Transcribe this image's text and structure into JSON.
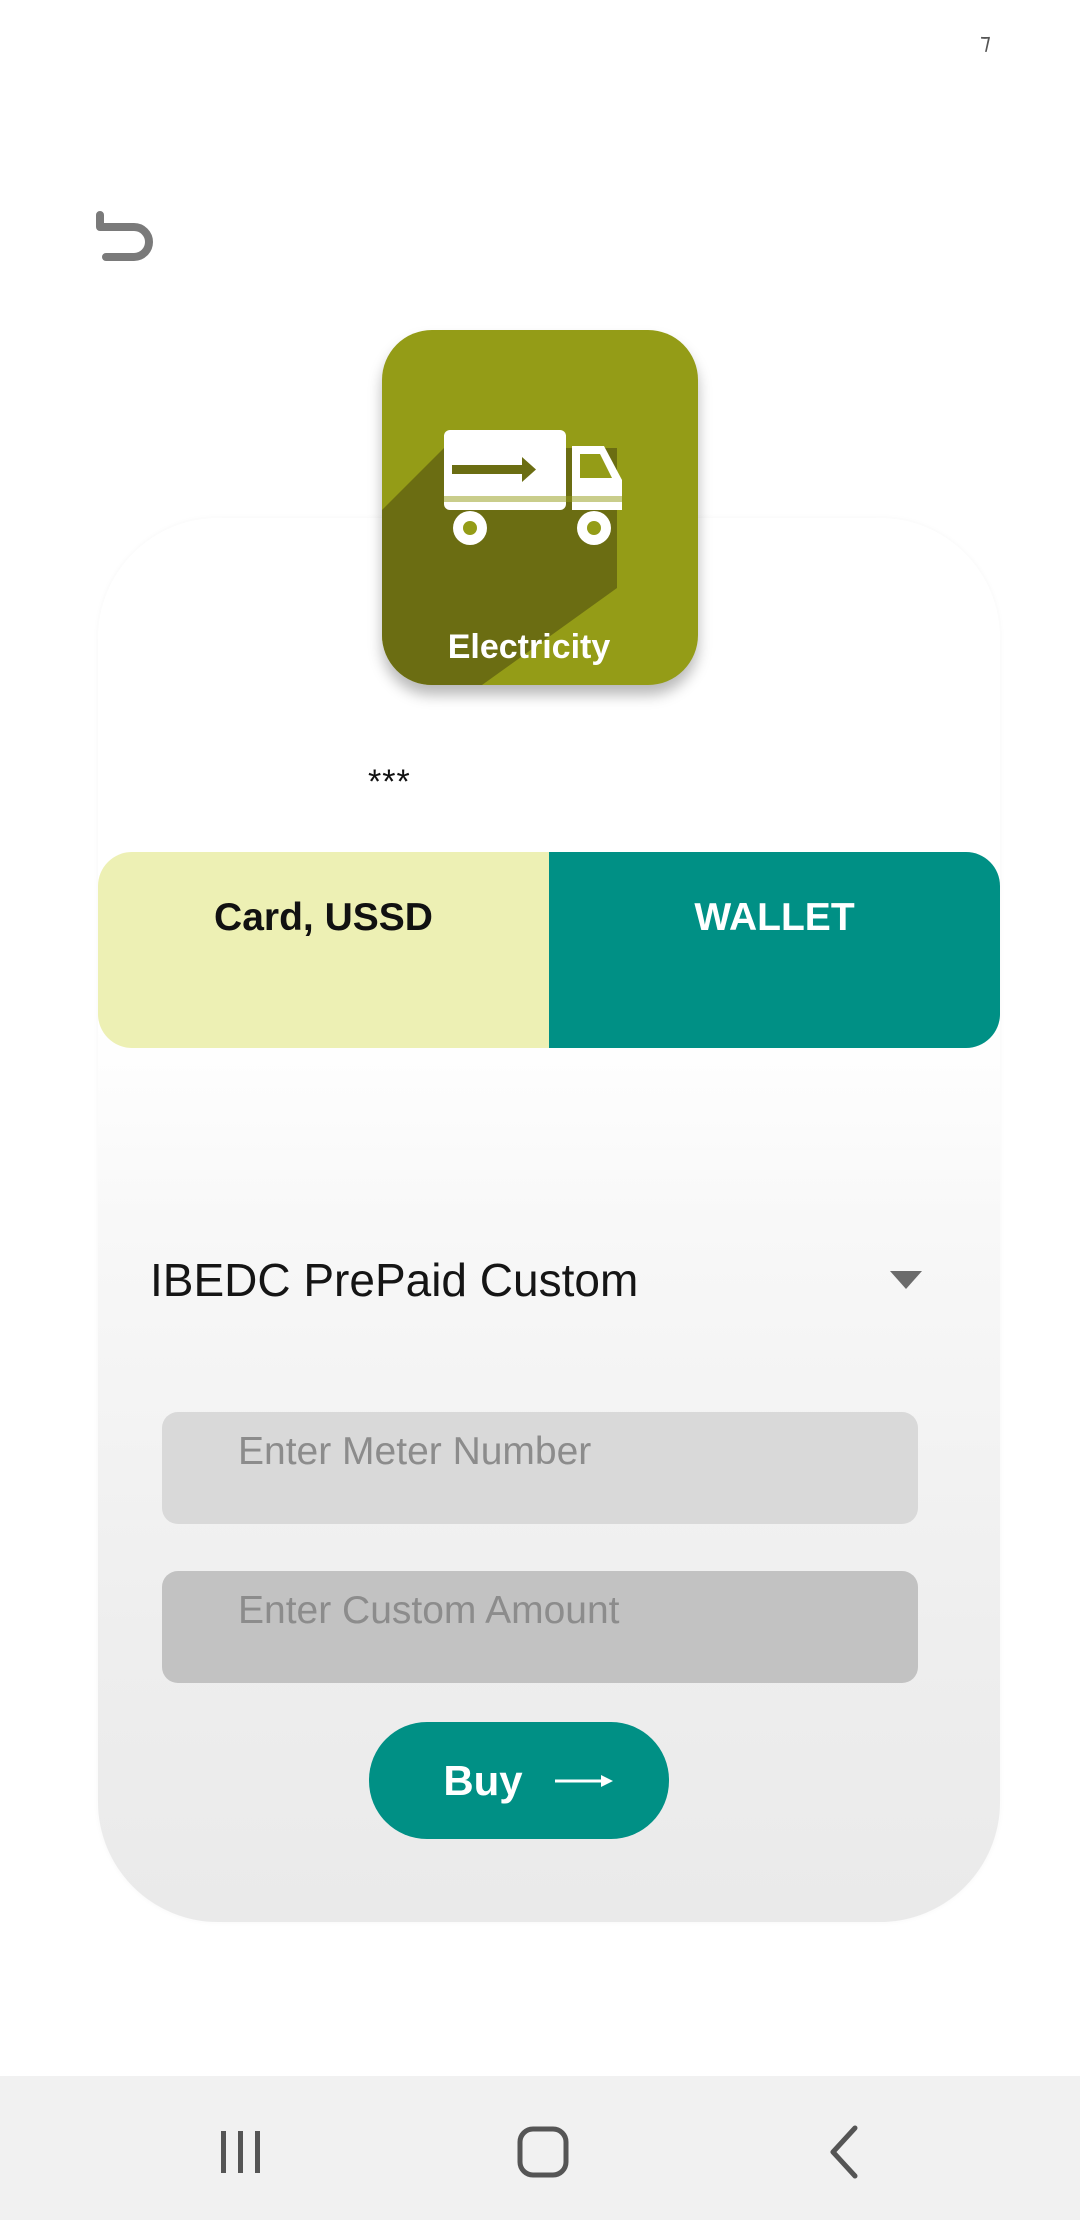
{
  "status": {
    "indicator": "⁊"
  },
  "icon_tile": {
    "label": "Electricity",
    "color": "#949c17"
  },
  "masked_text": "***",
  "payment_tabs": [
    {
      "label": "Card, USSD",
      "color": "#edf0b4"
    },
    {
      "label": "WALLET",
      "color": "#009085",
      "selected": true
    }
  ],
  "dropdown": {
    "selected": "IBEDC PrePaid Custom"
  },
  "inputs": {
    "meter": {
      "placeholder": "Enter Meter Number",
      "value": ""
    },
    "amount": {
      "placeholder": "Enter Custom Amount",
      "value": ""
    }
  },
  "buy_button": {
    "label": "Buy",
    "color": "#009085"
  },
  "icons": {
    "back": "undo-arrow-icon",
    "tile": "delivery-truck-icon",
    "buy": "long-arrow-right-icon",
    "nav_recents": "recents-icon",
    "nav_home": "home-icon",
    "nav_back": "back-icon"
  }
}
